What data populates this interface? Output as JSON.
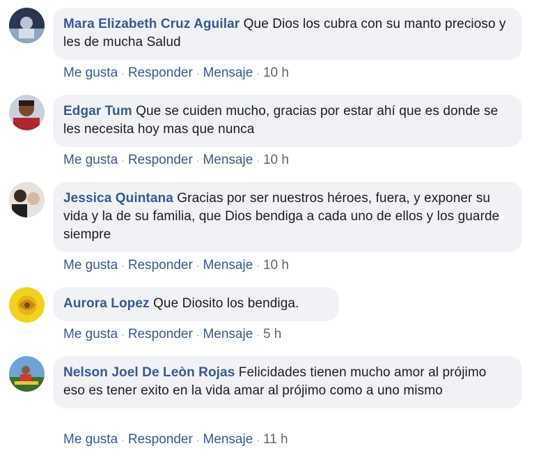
{
  "comments": [
    {
      "author": "Mara Elizabeth Cruz Aguilar",
      "text": "Que Dios los cubra con su manto precioso y les de mucha Salud",
      "time": "10 h",
      "avatar": "avatar-icon"
    },
    {
      "author": "Edgar Tum",
      "text": "Que se cuiden mucho, gracias por estar ahí que es donde se les necesita hoy mas que nunca",
      "time": "10 h",
      "avatar": "avatar-icon"
    },
    {
      "author": "Jessica Quintana",
      "text": "Gracias por ser nuestros héroes, fuera, y exponer su vida y la de su familia, que Dios bendiga a cada uno de ellos y los guarde siempre",
      "time": "10 h",
      "avatar": "avatar-icon"
    },
    {
      "author": "Aurora Lopez",
      "text": "Que Diosito los bendiga.",
      "time": "5 h",
      "avatar": "avatar-icon"
    },
    {
      "author": "Nelson Joel De Leòn Rojas",
      "text": "Felicidades tienen mucho amor al prójimo eso es tener exito en la vida amar al prójimo como a uno mismo",
      "time": "11 h",
      "avatar": "avatar-icon"
    }
  ],
  "actions": {
    "like": "Me gusta",
    "reply": "Responder",
    "message": "Mensaje",
    "separator": "·"
  },
  "colors": {
    "link": "#385898",
    "bubble": "#f0f2f5",
    "meta": "#616770"
  }
}
